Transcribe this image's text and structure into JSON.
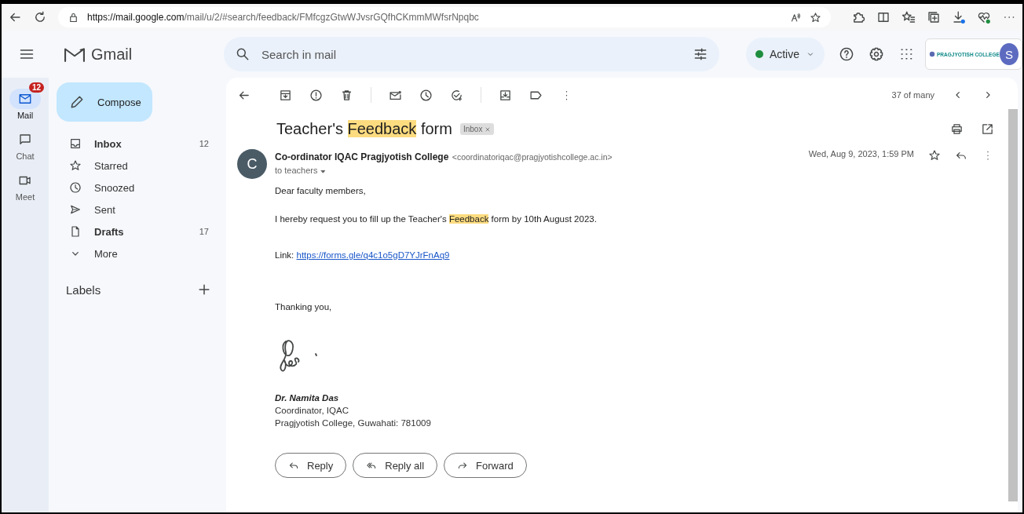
{
  "browser": {
    "url_host": "https://mail.google.com",
    "url_path": "/mail/u/2/#search/feedback/FMfcgzGtwWJvsrGQfhCKmmMWfsrNpqbc"
  },
  "header": {
    "app_name": "Gmail",
    "search": {
      "placeholder": "Search in mail"
    },
    "status": {
      "label": "Active",
      "color": "#1e8e3e"
    },
    "org_logo": "PRAGJYOTISH COLLEGE",
    "avatar": "S"
  },
  "rail": [
    {
      "label": "Mail",
      "selected": true,
      "badge": "12"
    },
    {
      "label": "Chat",
      "selected": false
    },
    {
      "label": "Meet",
      "selected": false
    }
  ],
  "compose": "Compose",
  "folders": [
    {
      "label": "Inbox",
      "count": "12",
      "selected": false,
      "bold": true
    },
    {
      "label": "Starred",
      "selected": false,
      "bold": false
    },
    {
      "label": "Snoozed",
      "selected": false,
      "bold": false
    },
    {
      "label": "Sent",
      "selected": false,
      "bold": false
    },
    {
      "label": "Drafts",
      "count": "17",
      "selected": false,
      "bold": true
    },
    {
      "label": "More",
      "selected": false,
      "bold": false
    }
  ],
  "labels_heading": "Labels",
  "pager": "37 of many",
  "message": {
    "subject": [
      {
        "text": "Teacher's ",
        "highlighted": false
      },
      {
        "text": "Feedback",
        "highlighted": true
      },
      {
        "text": " form",
        "highlighted": false
      }
    ],
    "label_chip": "Inbox",
    "sender_initial": "C",
    "sender_name": "Co-ordinator IQAC Pragjyotish College",
    "sender_email": "<coordinatoriqac@pragjyotishcollege.ac.in>",
    "recipients": "to teachers",
    "date": "Wed, Aug 9, 2023, 1:59 PM",
    "greeting": "Dear faculty members,",
    "request": [
      {
        "text": "I hereby request you to fill up the Teacher's ",
        "highlighted": false
      },
      {
        "text": "Feedback",
        "highlighted": true
      },
      {
        "text": " form by 10th August 2023.",
        "highlighted": false
      }
    ],
    "link_label": "Link:",
    "link": "https://forms.gle/q4c1o5gD7YJrFnAq9",
    "closing": "Thanking you,",
    "signer": "Dr. Namita Das",
    "signer_lines": [
      "Coordinator, IQAC",
      "Pragjyotish College, Guwahati: 781009"
    ]
  },
  "actions": [
    "Reply",
    "Reply all",
    "Forward"
  ]
}
